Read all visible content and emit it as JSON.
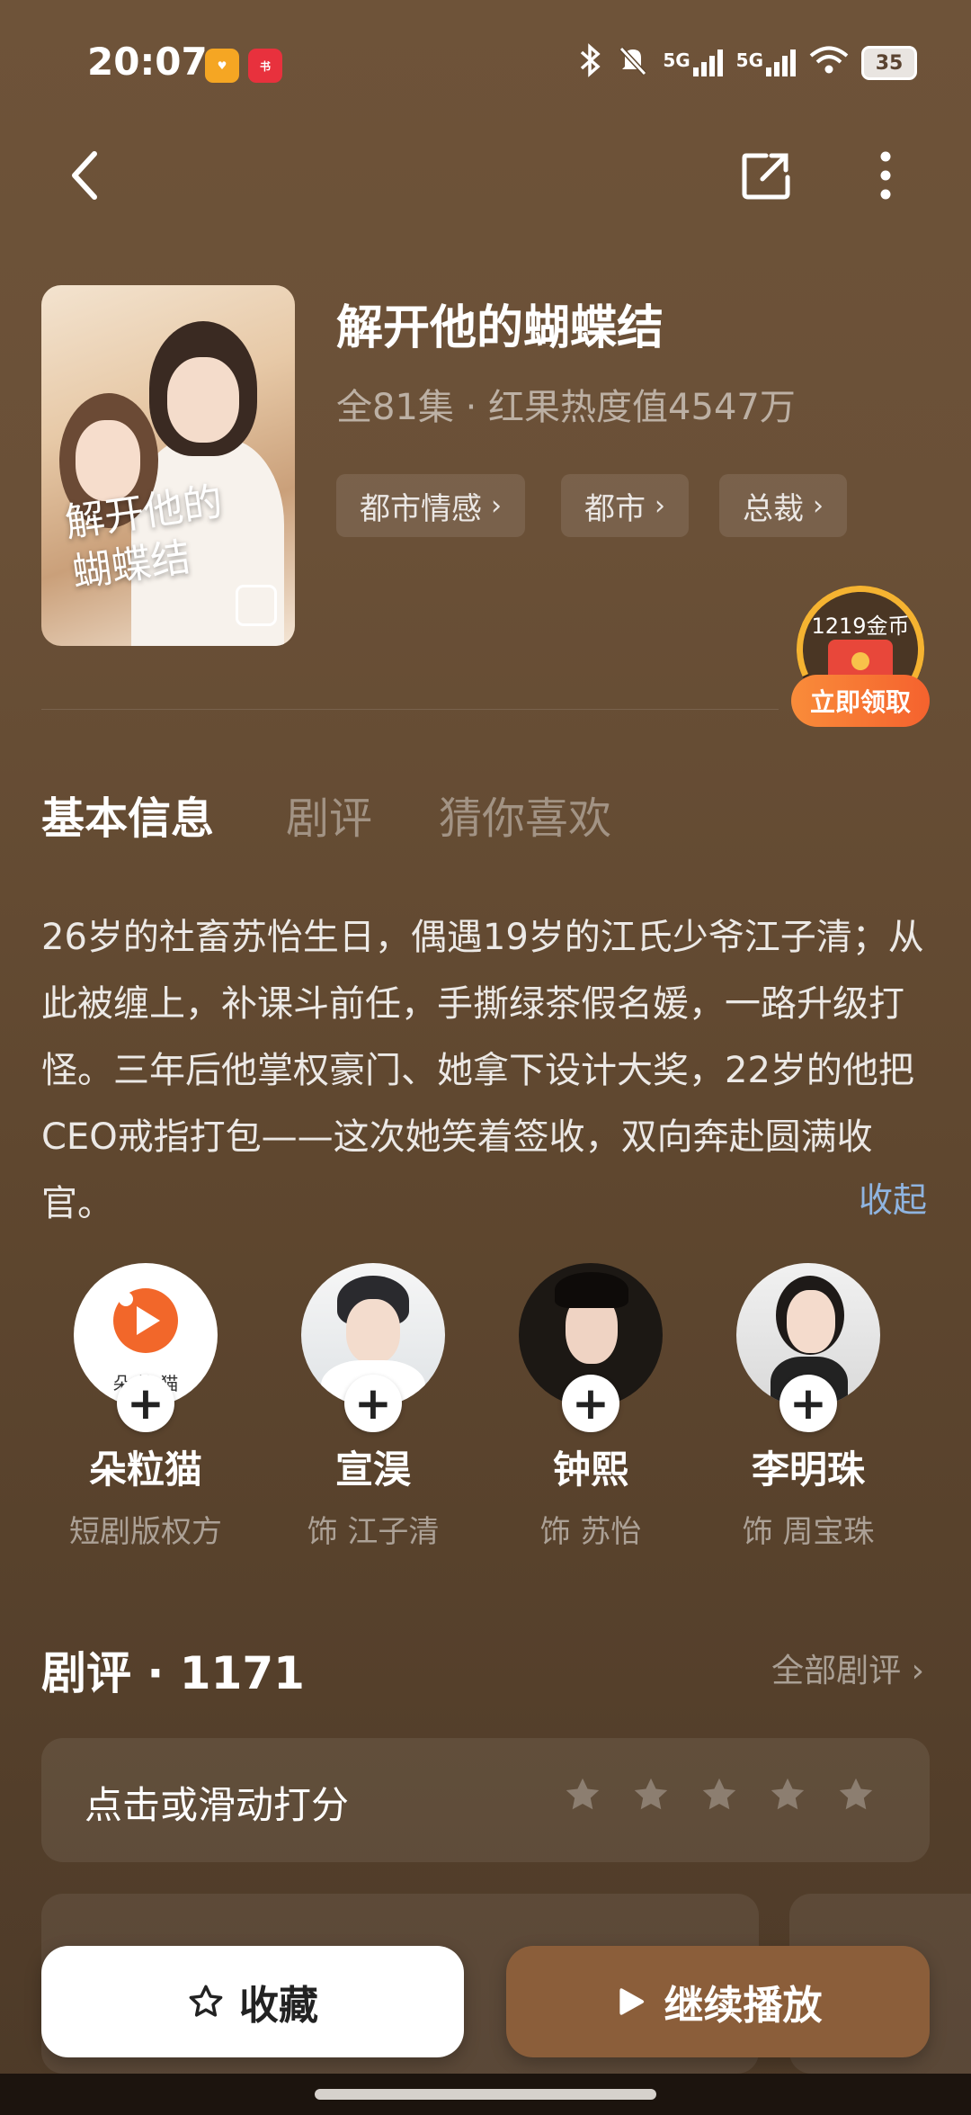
{
  "status_bar": {
    "time": "20:07",
    "signal_label_1": "5G",
    "signal_label_2": "5G",
    "battery": "35"
  },
  "show": {
    "title": "解开他的蝴蝶结",
    "meta": "全81集 · 红果热度值4547万",
    "poster_art_line1": "解开他的",
    "poster_art_line2": "蝴蝶结",
    "tags": [
      "都市情感",
      "都市",
      "总裁"
    ]
  },
  "coin_widget": {
    "amount": "1219金币",
    "claim_label": "立即领取"
  },
  "tabs": [
    {
      "label": "基本信息",
      "active": true
    },
    {
      "label": "剧评",
      "active": false
    },
    {
      "label": "猜你喜欢",
      "active": false
    }
  ],
  "description": {
    "text": "26岁的社畜苏怡生日，偶遇19岁的江氏少爷江子清；从此被缠上，补课斗前任，手撕绿茶假名媛，一路升级打怪。三年后他掌权豪门、她拿下设计大奖，22岁的他把CEO戒指打包——这次她笑着签收，双向奔赴圆满收官。",
    "collapse_label": "收起"
  },
  "cast": [
    {
      "name": "朵粒猫",
      "role": "短剧版权方",
      "logo_text": "朵 粒 猫"
    },
    {
      "name": "宣淏",
      "role": "饰 江子清"
    },
    {
      "name": "钟熙",
      "role": "饰 苏怡"
    },
    {
      "name": "李明珠",
      "role": "饰 周宝珠"
    }
  ],
  "reviews": {
    "title": "剧评 · 1171",
    "all_label": "全部剧评",
    "rate_prompt": "点击或滑动打分",
    "star_count": 5
  },
  "actions": {
    "favorite_label": "收藏",
    "play_label": "继续播放"
  },
  "colors": {
    "accent_link": "#8fb4e0",
    "play_button": "#8b5e3a",
    "claim_button": "#f5622e"
  }
}
